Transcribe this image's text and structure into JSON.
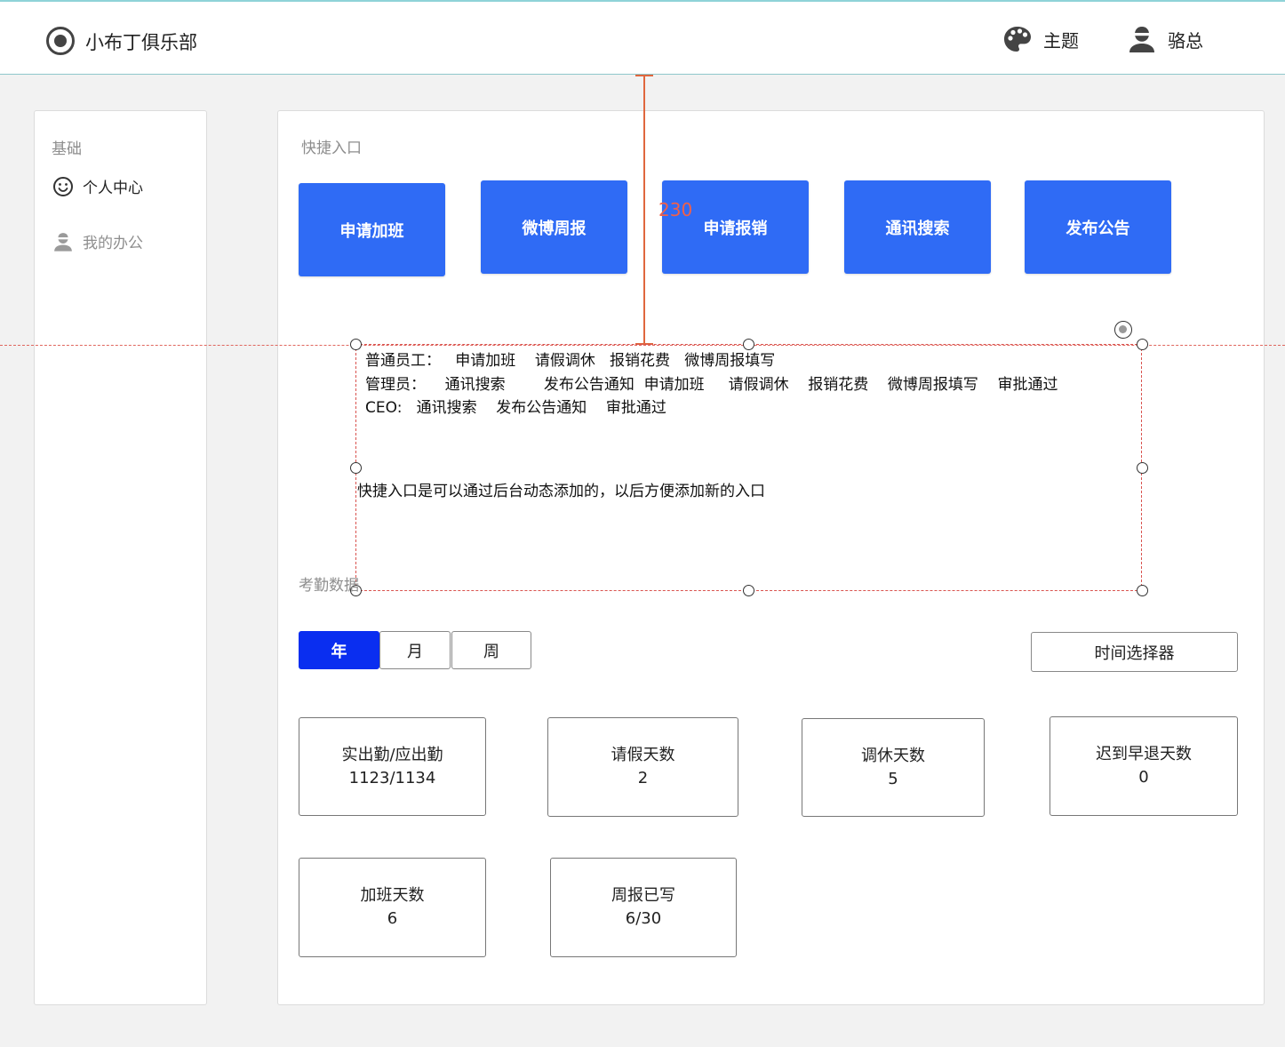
{
  "header": {
    "app_name": "小布丁俱乐部",
    "theme_label": "主题",
    "user_name": "骆总"
  },
  "sidebar": {
    "group_title": "基础",
    "items": [
      {
        "label": "个人中心",
        "icon": "smiley-icon"
      },
      {
        "label": "我的办公",
        "icon": "user-icon"
      }
    ]
  },
  "quick_entry": {
    "title": "快捷入口",
    "buttons": [
      "申请加班",
      "微博周报",
      "申请报销",
      "通讯搜索",
      "发布公告"
    ],
    "button_color": "#2f6bf5"
  },
  "annotation": {
    "measure_value": "230",
    "lines": [
      "普通员工：   申请加班    请假调休   报销花费   微博周报填写",
      "管理员：    通讯搜索        发布公告通知  申请加班     请假调休    报销花费    微博周报填写    审批通过",
      "CEO:   通讯搜索    发布公告通知    审批通过"
    ],
    "note": "快捷入口是可以通过后台动态添加的，以后方便添加新的入口"
  },
  "attendance": {
    "title": "考勤数据",
    "tabs": [
      {
        "label": "年",
        "active": true
      },
      {
        "label": "月",
        "active": false
      },
      {
        "label": "周",
        "active": false
      }
    ],
    "time_picker_label": "时间选择器",
    "active_color": "#0a2ef0",
    "cards": [
      {
        "title": "实出勤/应出勤",
        "value": "1123/1134"
      },
      {
        "title": "请假天数",
        "value": "2"
      },
      {
        "title": "调休天数",
        "value": "5"
      },
      {
        "title": "迟到早退天数",
        "value": "0"
      },
      {
        "title": "加班天数",
        "value": "6"
      },
      {
        "title": "周报已写",
        "value": "6/30"
      }
    ]
  }
}
